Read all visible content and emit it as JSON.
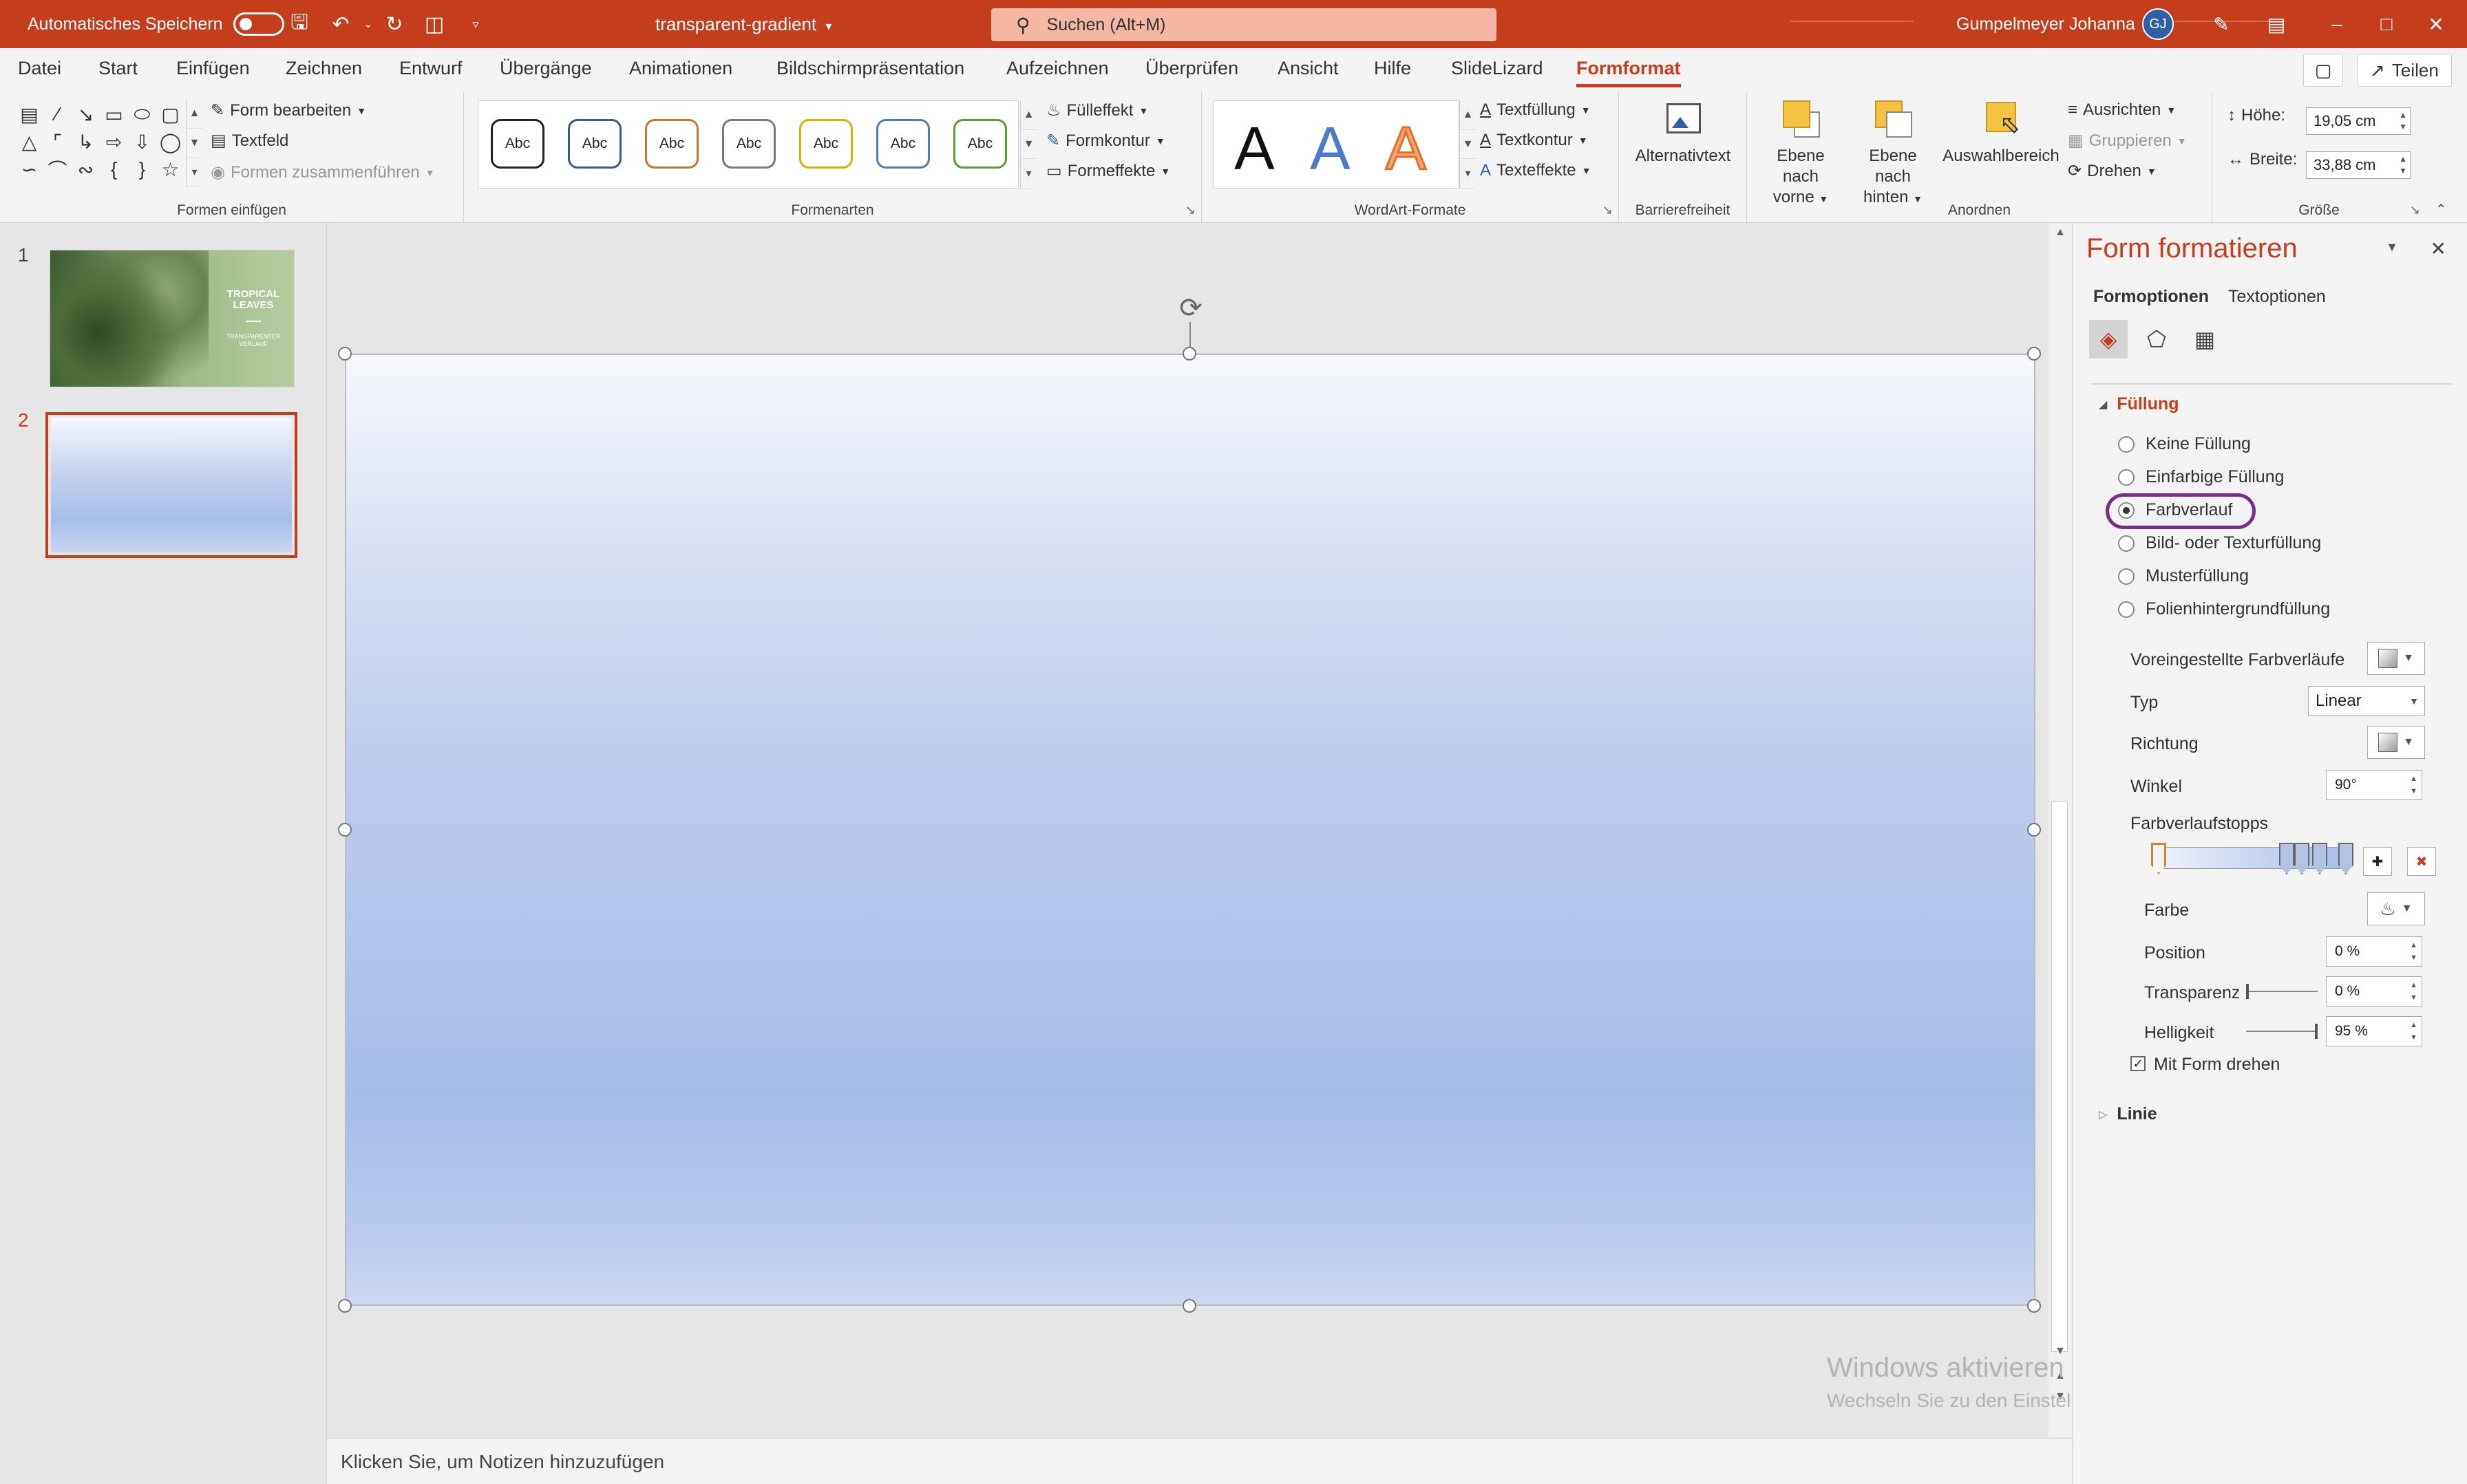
{
  "titlebar": {
    "autosave_label": "Automatisches Speichern",
    "doc_title": "transparent-gradient",
    "search_placeholder": "Suchen (Alt+M)",
    "username": "Gumpelmeyer Johanna",
    "avatar_initials": "GJ"
  },
  "tabs": [
    "Datei",
    "Start",
    "Einfügen",
    "Zeichnen",
    "Entwurf",
    "Übergänge",
    "Animationen",
    "Bildschirmpräsentation",
    "Aufzeichnen",
    "Überprüfen",
    "Ansicht",
    "Hilfe",
    "SlideLizard",
    "Formformat"
  ],
  "share_label": "Teilen",
  "ribbon": {
    "insert_shapes": {
      "label": "Formen einfügen",
      "edit_shape": "Form bearbeiten",
      "textbox": "Textfeld",
      "merge_shapes": "Formen zusammenführen"
    },
    "shape_styles": {
      "label": "Formenarten",
      "swatch_text": "Abc",
      "swatch_colors": [
        "#222222",
        "#3a5a8c",
        "#c47a2c",
        "#7a7a7a",
        "#d9b300",
        "#4a7cb5",
        "#5c9b3a"
      ],
      "fill_effect": "Fülleffekt",
      "outline": "Formkontur",
      "effects": "Formeffekte"
    },
    "wordart": {
      "label": "WordArt-Formate",
      "letter": "A",
      "text_fill": "Textfüllung",
      "text_outline": "Textkontur",
      "text_effects": "Texteffekte"
    },
    "accessibility": {
      "label": "Barrierefreiheit",
      "alt_text": "Alternativtext"
    },
    "arrange": {
      "label": "Anordnen",
      "bring_forward_1": "Ebene nach",
      "bring_forward_2": "vorne",
      "send_backward_1": "Ebene nach",
      "send_backward_2": "hinten",
      "selection_pane": "Auswahlbereich",
      "align": "Ausrichten",
      "group": "Gruppieren",
      "rotate": "Drehen"
    },
    "size": {
      "label": "Größe",
      "height_label": "Höhe:",
      "height_value": "19,05 cm",
      "width_label": "Breite:",
      "width_value": "33,88 cm"
    }
  },
  "thumbnails": [
    {
      "num": "1",
      "title": "TROPICAL LEAVES",
      "subtitle": "TRANSPARENTER VERLAUF"
    },
    {
      "num": "2"
    }
  ],
  "notes_placeholder": "Klicken Sie, um Notizen hinzuzufügen",
  "watermark": {
    "line1": "Windows aktivieren",
    "line2": "Wechseln Sie zu den Einstellungen, um Windows zu aktivieren."
  },
  "format_pane": {
    "title": "Form formatieren",
    "tabs": [
      "Formoptionen",
      "Textoptionen"
    ],
    "fill_section": "Füllung",
    "fill_options": [
      "Keine Füllung",
      "Einfarbige Füllung",
      "Farbverlauf",
      "Bild- oder Texturfüllung",
      "Musterfüllung",
      "Folienhintergrundfüllung"
    ],
    "selected_fill": "Farbverlauf",
    "preset_label": "Voreingestellte Farbverläufe",
    "type_label": "Typ",
    "type_value": "Linear",
    "direction_label": "Richtung",
    "angle_label": "Winkel",
    "angle_value": "90°",
    "stops_label": "Farbverlaufstopps",
    "color_label": "Farbe",
    "position_label": "Position",
    "position_value": "0 %",
    "transparency_label": "Transparenz",
    "transparency_value": "0 %",
    "brightness_label": "Helligkeit",
    "brightness_value": "95 %",
    "rotate_with_shape": "Mit Form drehen",
    "line_section": "Linie"
  },
  "colors": {
    "accent": "#c43e1c",
    "highlight": "#7b2d8e"
  }
}
